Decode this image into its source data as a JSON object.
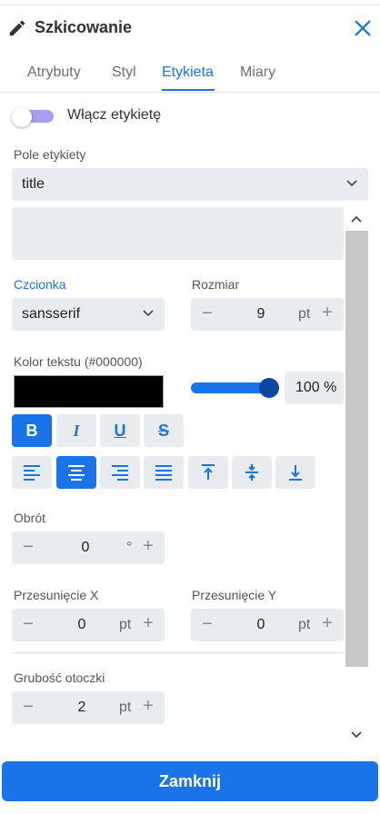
{
  "header": {
    "title": "Szkicowanie"
  },
  "tabs": [
    {
      "label": "Atrybuty"
    },
    {
      "label": "Styl"
    },
    {
      "label": "Etykieta",
      "active": true
    },
    {
      "label": "Miary"
    }
  ],
  "toggle": {
    "label": "Włącz etykietę",
    "on": false
  },
  "label_field": {
    "label": "Pole etykiety",
    "value": "title",
    "expression": ""
  },
  "font": {
    "label": "Czcionka",
    "value": "sansserif"
  },
  "size": {
    "label": "Rozmiar",
    "value": "9",
    "unit": "pt"
  },
  "text_color": {
    "label": "Kolor tekstu (#000000)",
    "color": "#000000",
    "opacity_percent": 100,
    "opacity_value": "100",
    "opacity_unit": "%"
  },
  "format_buttons": {
    "bold": "B",
    "italic": "I",
    "underline": "U",
    "strike": "S"
  },
  "rotation": {
    "label": "Obrót",
    "value": "0",
    "unit": "°"
  },
  "offset_x": {
    "label": "Przesunięcie X",
    "value": "0",
    "unit": "pt"
  },
  "offset_y": {
    "label": "Przesunięcie Y",
    "value": "0",
    "unit": "pt"
  },
  "halo": {
    "label": "Grubość otoczki",
    "value": "2",
    "unit": "pt"
  },
  "footer": {
    "close_label": "Zamknij"
  },
  "colors": {
    "accent": "#1a73e8",
    "toggle_track": "#a5a0f4",
    "field_bg": "#e9ecef"
  }
}
